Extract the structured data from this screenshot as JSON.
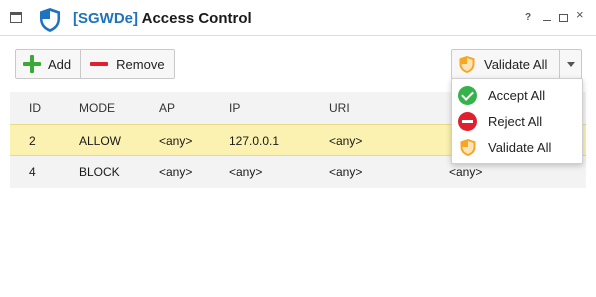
{
  "window": {
    "title_tag": "[SGWDe]",
    "title": "Access Control",
    "controls": {
      "help": "?",
      "close": "×"
    }
  },
  "toolbar": {
    "add_label": "Add",
    "remove_label": "Remove",
    "validate_label": "Validate All"
  },
  "table": {
    "columns": [
      "ID",
      "MODE",
      "AP",
      "IP",
      "URI"
    ],
    "rows": [
      {
        "id": "2",
        "mode": "ALLOW",
        "ap": "<any>",
        "ip": "127.0.0.1",
        "uri": "<any>",
        "extra": ""
      },
      {
        "id": "4",
        "mode": "BLOCK",
        "ap": "<any>",
        "ip": "<any>",
        "uri": "<any>",
        "extra": "<any>"
      }
    ],
    "selected_row": 0
  },
  "dropdown_menu": {
    "items": [
      {
        "label": "Accept All",
        "icon": "check-circle-icon"
      },
      {
        "label": "Reject All",
        "icon": "minus-circle-icon"
      },
      {
        "label": "Validate All",
        "icon": "shield-icon"
      }
    ]
  },
  "colors": {
    "brand": "#1e73be",
    "selected_row": "#fbf1b0",
    "accept": "#36b24a",
    "reject": "#e0202f",
    "shield": "#f5a623"
  }
}
